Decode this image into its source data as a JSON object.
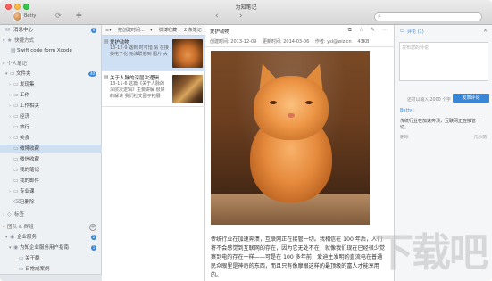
{
  "window": {
    "title": "为知笔记"
  },
  "account": {
    "user": "Betty"
  },
  "toolbar": {
    "back_arrow": "‹",
    "forward_arrow": "›"
  },
  "sidebar": {
    "items": [
      {
        "label": "消息中心",
        "icon": "bell-icon",
        "glyph": "✉",
        "badge": "6"
      },
      {
        "label": "快捷方式",
        "icon": "star-icon",
        "glyph": "★",
        "section": true
      },
      {
        "label": "Swift code form Xcode",
        "icon": "doc-icon",
        "glyph": "▤"
      },
      {
        "label": "个人笔记",
        "section": true
      },
      {
        "label": "文件夹",
        "icon": "folder-icon",
        "glyph": "▸",
        "badge": "40"
      },
      {
        "label": "发现集",
        "icon": "folder-icon",
        "glyph": "▭"
      },
      {
        "label": "工作",
        "icon": "folder-icon",
        "glyph": "▭"
      },
      {
        "label": "工作相关",
        "icon": "folder-icon",
        "glyph": "▭"
      },
      {
        "label": "经济",
        "icon": "folder-icon",
        "glyph": "▭"
      },
      {
        "label": "旅行",
        "icon": "folder-icon",
        "glyph": "▭"
      },
      {
        "label": "美食",
        "icon": "folder-icon",
        "glyph": "▭"
      },
      {
        "label": "微博收藏",
        "icon": "folder-icon",
        "glyph": "▭",
        "selected": true
      },
      {
        "label": "微信收藏",
        "icon": "folder-icon",
        "glyph": "▭"
      },
      {
        "label": "我的笔记",
        "icon": "folder-icon",
        "glyph": "▭"
      },
      {
        "label": "我的邮件",
        "icon": "folder-icon",
        "glyph": "▭"
      },
      {
        "label": "专业课",
        "icon": "folder-icon",
        "glyph": "▭"
      },
      {
        "label": "已删除",
        "icon": "trash-icon",
        "glyph": "🗑"
      },
      {
        "label": "标签",
        "icon": "tag-icon",
        "glyph": "◇",
        "section": true
      },
      {
        "label": "团队 & 群组",
        "section": true
      },
      {
        "label": "企业服务",
        "icon": "group-icon",
        "glyph": "▸",
        "badge": "2"
      },
      {
        "label": "为知企业服务用户指南",
        "icon": "group-icon",
        "glyph": "▾"
      },
      {
        "label": "关于群",
        "icon": "folder-icon",
        "glyph": "▭"
      },
      {
        "label": "日常成案例",
        "icon": "folder-icon",
        "glyph": "▭"
      }
    ]
  },
  "notelist": {
    "sort_label": "按创建时间...",
    "folder_label": "微博收藏",
    "count_label": "2 条笔记",
    "notes": [
      {
        "title": "爱护动物",
        "snippet": "13-12-9 遇到 时可惜 情 在接受电子化 无法联想到 图片 大",
        "selected": true
      },
      {
        "title": "关于人脉的深层次逻辑",
        "snippet": "13-11-6 这篇《关于人脉的深层次逻辑》主要讲解 很好的解读 我们社交圈子拓展",
        "selected": false
      }
    ]
  },
  "editor": {
    "title": "爱护动物",
    "created": "创建时间: 2013-12-09",
    "modified": "更新时间: 2014-03-06",
    "author": "作者: ysl@wiz.cn",
    "size": "43KB",
    "tools": "⧉ ☆ ✎ ⋯",
    "body": "传统行业在加速奔溃，互联网正在接管一切。我相信在 100 年后，人们将不会感觉到互联网的存在，因为它无处不在，就像我们现在已经很少觉察到电的存在一样——可是在 100 多年前，爱迪生发明的直流电在普通民众眼里是神奇的东西，而且只有像摩根这样的最顶级的富人才能享用的。"
  },
  "comments": {
    "title": "评论 (1)",
    "input_placeholder": "发布您的评论",
    "char_limit": "还可以输入 2000 个字",
    "submit_label": "发表评论",
    "author": "Betty :",
    "body": "传统行业在加速奔溃，互联网正在接管一切。",
    "delete_label": "删除",
    "time": "几秒前"
  },
  "watermark": "下载吧",
  "colors": {
    "accent": "#3a86d6",
    "selection": "#cfdff2"
  }
}
